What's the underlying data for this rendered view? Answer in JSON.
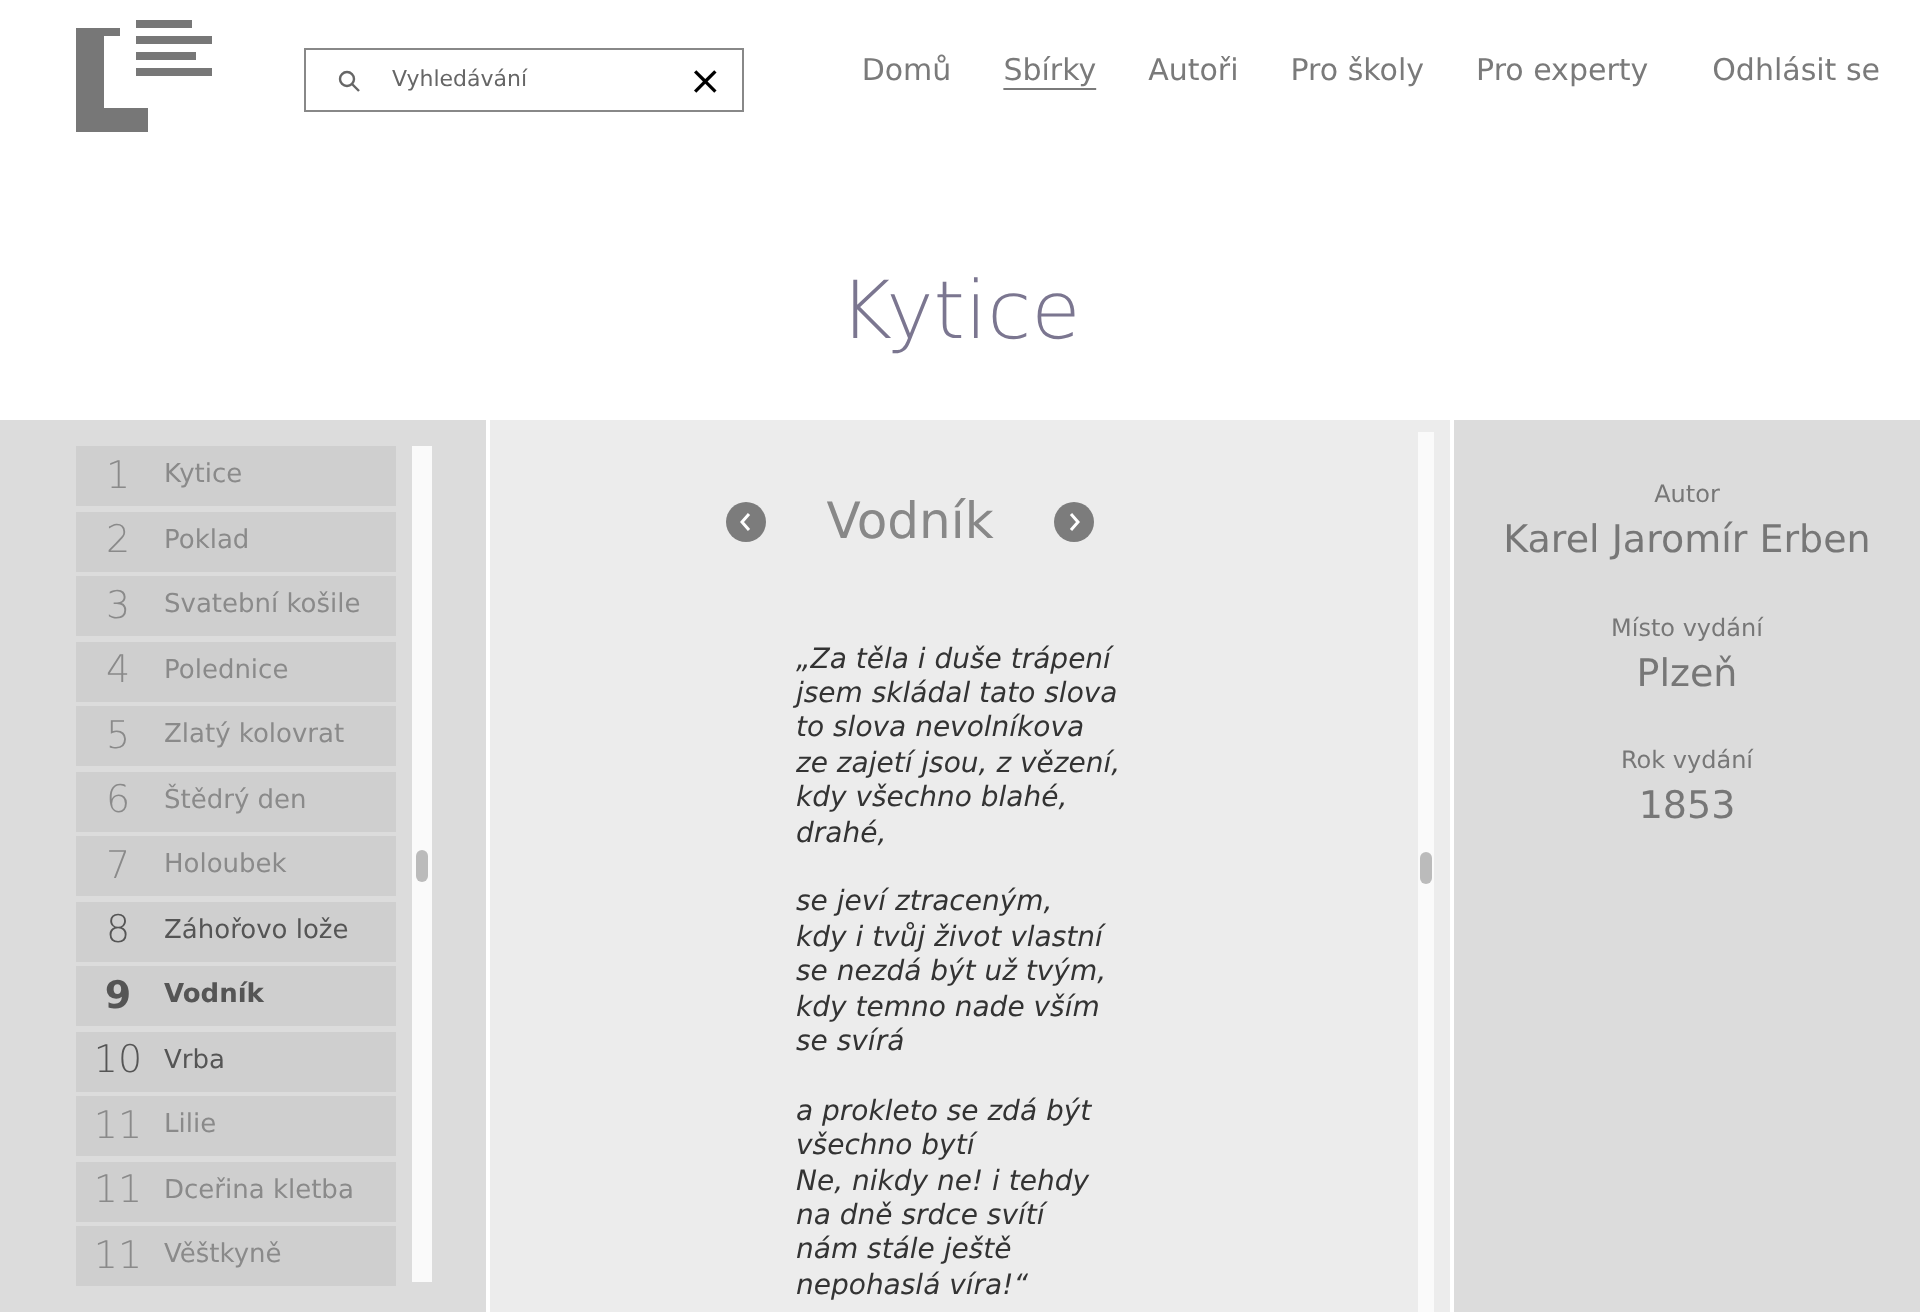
{
  "search": {
    "placeholder": "Vyhledávání",
    "clear": "×"
  },
  "nav": [
    {
      "label": "Domů",
      "selected": false
    },
    {
      "label": "Sbírky",
      "selected": true
    },
    {
      "label": "Autoři",
      "selected": false
    },
    {
      "label": "Pro školy",
      "selected": false
    },
    {
      "label": "Pro experty",
      "selected": false
    },
    {
      "label": "Odhlásit se",
      "selected": false
    }
  ],
  "title": "Kytice",
  "poems": [
    {
      "number": "1",
      "title": "Kytice",
      "selected": false,
      "highlighted": false
    },
    {
      "number": "2",
      "title": "Poklad",
      "selected": false,
      "highlighted": false
    },
    {
      "number": "3",
      "title": "Svatební košile",
      "selected": false,
      "highlighted": false
    },
    {
      "number": "4",
      "title": "Polednice",
      "selected": false,
      "highlighted": false
    },
    {
      "number": "5",
      "title": "Zlatý kolovrat",
      "selected": false,
      "highlighted": false
    },
    {
      "number": "6",
      "title": "Štědrý den",
      "selected": false,
      "highlighted": false
    },
    {
      "number": "7",
      "title": "Holoubek",
      "selected": false,
      "highlighted": false
    },
    {
      "number": "8",
      "title": "Záhořovo lože",
      "selected": false,
      "highlighted": true
    },
    {
      "number": "9",
      "title": "Vodník",
      "selected": true,
      "highlighted": true
    },
    {
      "number": "10",
      "title": "Vrba",
      "selected": false,
      "highlighted": true
    },
    {
      "number": "11",
      "title": "Lilie",
      "selected": false,
      "highlighted": false
    },
    {
      "number": "11",
      "title": "Dceřina kletba",
      "selected": false,
      "highlighted": false
    },
    {
      "number": "11",
      "title": "Věštkyně",
      "selected": false,
      "highlighted": false
    }
  ],
  "poem": {
    "title": "Vodník",
    "stanzas": [
      [
        "„Za těla i duše trápení",
        "jsem skládal tato slova",
        "to slova nevolníkova",
        "ze zajetí jsou, z vězení,",
        "kdy všechno blahé,",
        "drahé,"
      ],
      [
        "se jeví ztraceným,",
        "kdy i tvůj život vlastní",
        "se nezdá být už tvým,",
        "kdy temno nade vším",
        "se svírá"
      ],
      [
        "a prokleto se zdá být",
        "všechno bytí",
        "Ne, nikdy ne! i tehdy",
        "na dně srdce svítí",
        "nám stále ještě",
        "nepohaslá víra!“"
      ]
    ]
  },
  "details": [
    {
      "label": "Autor",
      "value": "Karel Jaromír Erben"
    },
    {
      "label": "Místo vydání",
      "value": "Plzeň"
    },
    {
      "label": "Rok vydání",
      "value": "1853"
    }
  ]
}
